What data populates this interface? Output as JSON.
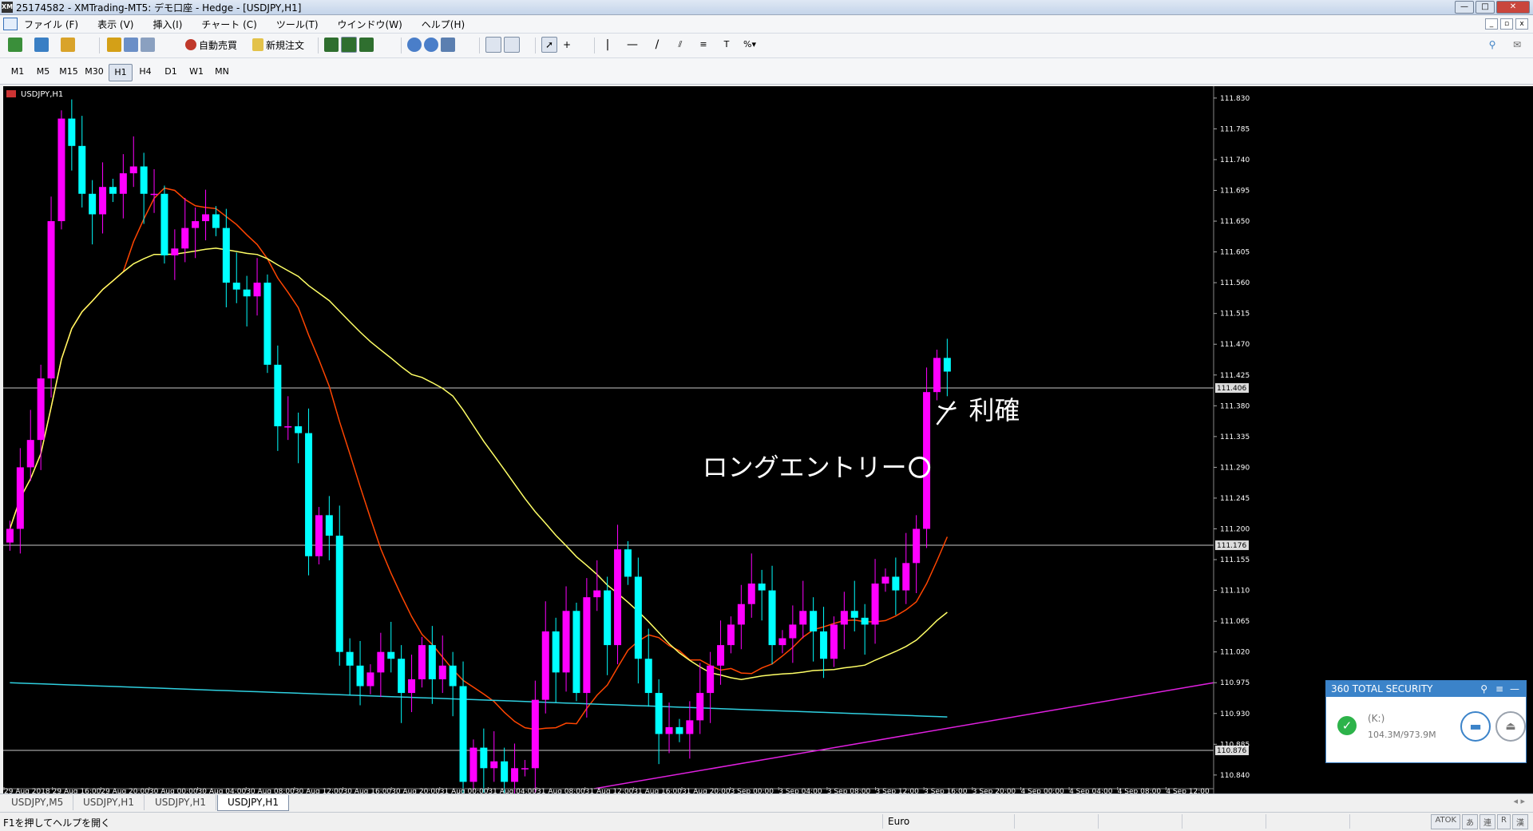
{
  "window": {
    "logo": "XM",
    "title": "25174582 - XMTrading-MT5: デモ口座 - Hedge - [USDJPY,H1]",
    "buttons": [
      "—",
      "□",
      "✕"
    ]
  },
  "menu": [
    "ファイル (F)",
    "表示 (V)",
    "挿入(I)",
    "チャート (C)",
    "ツール(T)",
    "ウインドウ(W)",
    "ヘルプ(H)"
  ],
  "toolbar": {
    "auto_trading": "自動売買",
    "new_order": "新規注文"
  },
  "timeframes": [
    "M1",
    "M5",
    "M15",
    "M30",
    "H1",
    "H4",
    "D1",
    "W1",
    "MN"
  ],
  "active_timeframe": "H1",
  "chart": {
    "symbol_label": "USDJPY,H1",
    "price_ticks": [
      "111.830",
      "111.785",
      "111.740",
      "111.695",
      "111.650",
      "111.605",
      "111.560",
      "111.515",
      "111.470",
      "111.425",
      "111.380",
      "111.335",
      "111.290",
      "111.245",
      "111.200",
      "111.155",
      "111.110",
      "111.065",
      "111.020",
      "110.975",
      "110.930",
      "110.885",
      "110.840"
    ],
    "hline_labels": [
      "111.406",
      "111.176",
      "110.876"
    ],
    "time_labels": [
      "29 Aug 2018",
      "29 Aug 16:00",
      "29 Aug 20:00",
      "30 Aug 00:00",
      "30 Aug 04:00",
      "30 Aug 08:00",
      "30 Aug 12:00",
      "30 Aug 16:00",
      "30 Aug 20:00",
      "31 Aug 00:00",
      "31 Aug 04:00",
      "31 Aug 08:00",
      "31 Aug 12:00",
      "31 Aug 16:00",
      "31 Aug 20:00",
      "3 Sep 00:00",
      "3 Sep 04:00",
      "3 Sep 08:00",
      "3 Sep 12:00",
      "3 Sep 16:00",
      "3 Sep 20:00",
      "4 Sep 00:00",
      "4 Sep 04:00",
      "4 Sep 08:00",
      "4 Sep 12:00"
    ],
    "annotation_entry": "ロングエントリー",
    "annotation_exit": "利確",
    "colors": {
      "background": "#000000",
      "bull": "#ff00ff",
      "bear": "#00ffff",
      "ma_fast": "#ff4500",
      "ma_mid": "#ffff66",
      "ma_slow": "#2fd0e0",
      "trendline": "#e020e0",
      "hline": "#c8c8c8"
    }
  },
  "chart_data": {
    "type": "candlestick",
    "symbol": "USDJPY",
    "timeframe": "H1",
    "ylim": [
      110.82,
      111.845
    ],
    "price_unit": "JPY",
    "candles_close_approx": [
      111.2,
      111.29,
      111.33,
      111.42,
      111.65,
      111.8,
      111.76,
      111.69,
      111.66,
      111.7,
      111.69,
      111.72,
      111.73,
      111.69,
      111.69,
      111.6,
      111.61,
      111.64,
      111.65,
      111.66,
      111.64,
      111.56,
      111.55,
      111.54,
      111.56,
      111.44,
      111.35,
      111.35,
      111.34,
      111.16,
      111.22,
      111.19,
      111.02,
      111.0,
      110.97,
      110.99,
      111.02,
      111.01,
      110.96,
      110.98,
      111.03,
      110.98,
      111.0,
      110.97,
      110.83,
      110.88,
      110.85,
      110.86,
      110.83,
      110.85,
      110.85,
      110.95,
      111.05,
      110.99,
      111.08,
      110.96,
      111.1,
      111.11,
      111.03,
      111.17,
      111.13,
      111.01,
      110.96,
      110.9,
      110.91,
      110.9,
      110.92,
      110.96,
      111.0,
      111.03,
      111.06,
      111.09,
      111.12,
      111.11,
      111.03,
      111.04,
      111.06,
      111.08,
      111.05,
      111.01,
      111.06,
      111.08,
      111.07,
      111.06,
      111.12,
      111.13,
      111.11,
      111.15,
      111.2,
      111.4,
      111.45,
      111.43
    ],
    "indicators": [
      {
        "type": "moving_average",
        "color": "orange"
      },
      {
        "type": "moving_average",
        "color": "yellow"
      },
      {
        "type": "moving_average",
        "color": "cyan"
      }
    ],
    "horizontal_lines": [
      111.406,
      111.176,
      110.876
    ],
    "annotations": [
      "ロングエントリー",
      "利確"
    ]
  },
  "tabs": [
    "USDJPY,M5",
    "USDJPY,H1",
    "USDJPY,H1",
    "USDJPY,H1"
  ],
  "active_tab": 3,
  "status": {
    "help": "F1を押してヘルプを開く",
    "profile": "Euro",
    "ime": [
      "ATOK",
      "あ",
      "連",
      "R",
      "漢"
    ]
  },
  "security_popup": {
    "title": "360 TOTAL SECURITY",
    "drive": "(K:)",
    "size": "104.3M/973.9M"
  }
}
